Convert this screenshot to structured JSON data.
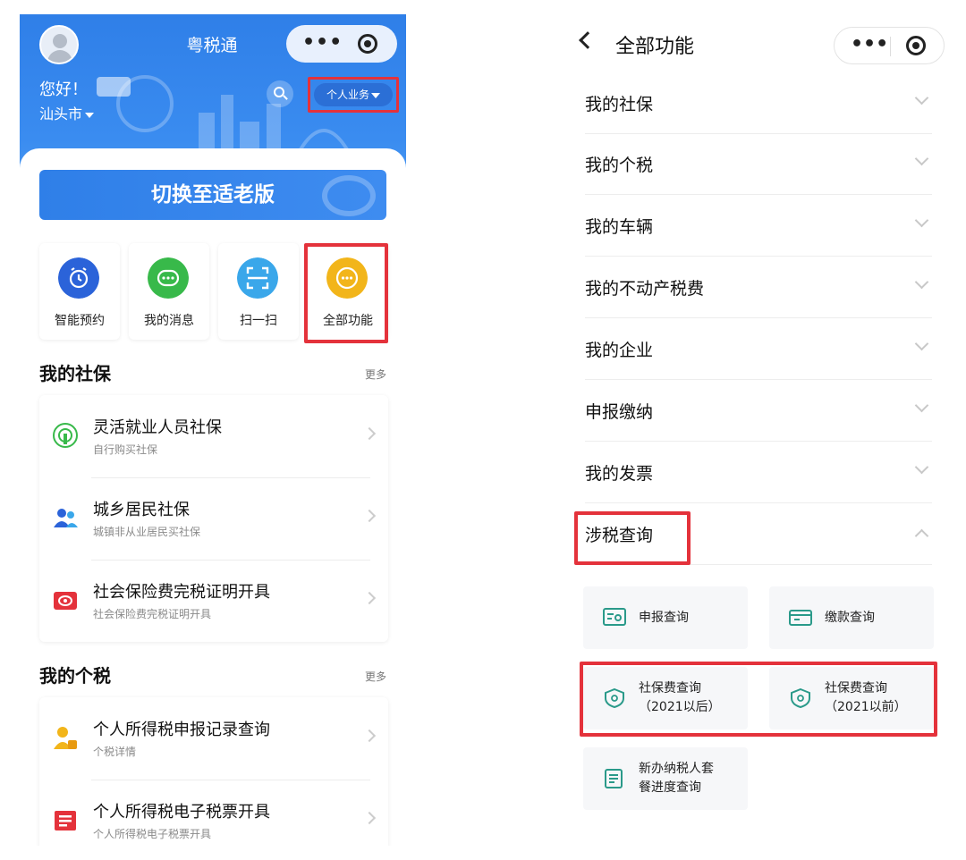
{
  "left": {
    "app_title": "粤税通",
    "greeting": "您好！",
    "city": "汕头市",
    "business_switch": "个人业务",
    "elder_mode_button": "切换至适老版",
    "quick_actions": [
      {
        "label": "智能预约",
        "color": "#2b63d9",
        "icon": "clock-icon"
      },
      {
        "label": "我的消息",
        "color": "#38b94a",
        "icon": "message-icon"
      },
      {
        "label": "扫一扫",
        "color": "#3aa7ea",
        "icon": "scan-icon"
      },
      {
        "label": "全部功能",
        "color": "#f2b51a",
        "icon": "more-icon"
      }
    ],
    "sections": [
      {
        "title": "我的社保",
        "more": "更多",
        "items": [
          {
            "title": "灵活就业人员社保",
            "subtitle": "自行购买社保",
            "icon": "signal-icon"
          },
          {
            "title": "城乡居民社保",
            "subtitle": "城镇非从业居民买社保",
            "icon": "people-icon"
          },
          {
            "title": "社会保险费完税证明开具",
            "subtitle": "社会保险费完税证明开具",
            "icon": "certificate-icon"
          }
        ]
      },
      {
        "title": "我的个税",
        "more": "更多",
        "items": [
          {
            "title": "个人所得税申报记录查询",
            "subtitle": "个税详情",
            "icon": "person-tax-icon"
          },
          {
            "title": "个人所得税电子税票开具",
            "subtitle": "个人所得税电子税票开具",
            "icon": "receipt-icon"
          }
        ]
      }
    ]
  },
  "right": {
    "title": "全部功能",
    "accordion": [
      {
        "label": "我的社保",
        "expanded": false
      },
      {
        "label": "我的个税",
        "expanded": false
      },
      {
        "label": "我的车辆",
        "expanded": false
      },
      {
        "label": "我的不动产税费",
        "expanded": false
      },
      {
        "label": "我的企业",
        "expanded": false
      },
      {
        "label": "申报缴纳",
        "expanded": false
      },
      {
        "label": "我的发票",
        "expanded": false
      },
      {
        "label": "涉税查询",
        "expanded": true
      }
    ],
    "tiles": [
      {
        "line1": "申报查询",
        "line2": "",
        "icon": "declaration-query-icon"
      },
      {
        "line1": "缴款查询",
        "line2": "",
        "icon": "payment-query-icon"
      },
      {
        "line1": "社保费查询",
        "line2": "（2021以后）",
        "icon": "shield-search-icon"
      },
      {
        "line1": "社保费查询",
        "line2": "（2021以前）",
        "icon": "shield-search-icon"
      },
      {
        "line1": "新办纳税人套",
        "line2": "餐进度查询",
        "icon": "document-icon"
      }
    ]
  },
  "colors": {
    "brand_blue": "#2f7fe8",
    "highlight_red": "#e4323b"
  }
}
